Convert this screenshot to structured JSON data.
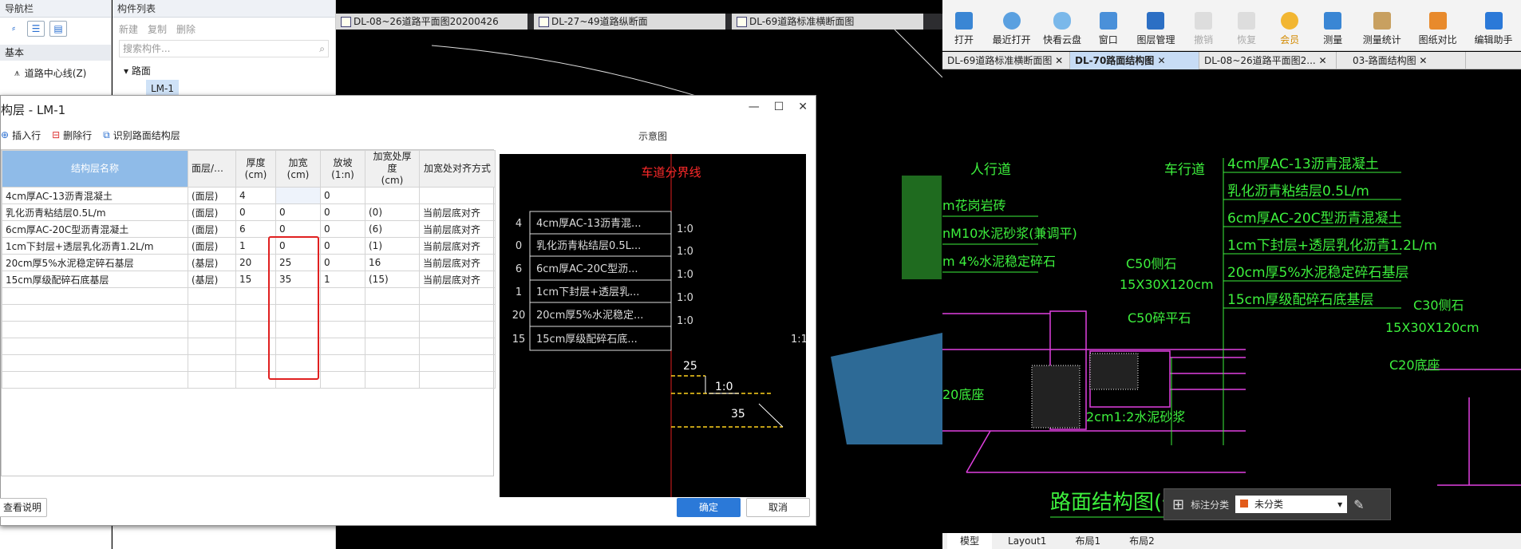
{
  "left_nav": {
    "title": "导航栏",
    "section": "基本",
    "item_label": "道路中心线(Z)"
  },
  "component_list": {
    "title": "构件列表",
    "tools": [
      "新建",
      "复制",
      "删除"
    ],
    "search_placeholder": "搜索构件...",
    "tree_root": "路面",
    "tree_child": "LM-1"
  },
  "cad_tabs": [
    "DL-08~26道路平面图20200426",
    "DL-27~49道路纵断面",
    "DL-69道路标准横断面图"
  ],
  "dialog": {
    "title": "构层 - LM-1",
    "toolbar": [
      "插入行",
      "删除行",
      "识别路面结构层"
    ],
    "scheme_title": "示意图",
    "headers": [
      "结构层名称",
      "面层/基层",
      "厚度\n(cm)",
      "加宽\n(cm)",
      "放坡\n(1:n)",
      "加宽处厚度\n(cm)",
      "加宽处对齐方式"
    ],
    "rows": [
      [
        "4cm厚AC-13沥青混凝土",
        "(面层)",
        "4",
        "",
        "0",
        "",
        ""
      ],
      [
        "乳化沥青粘结层0.5L/m",
        "(面层)",
        "0",
        "0",
        "0",
        "(0)",
        "当前层底对齐"
      ],
      [
        "6cm厚AC-20C型沥青混凝土",
        "(面层)",
        "6",
        "0",
        "0",
        "(6)",
        "当前层底对齐"
      ],
      [
        "1cm下封层+透层乳化沥青1.2L/m",
        "(面层)",
        "1",
        "0",
        "0",
        "(1)",
        "当前层底对齐"
      ],
      [
        "20cm厚5%水泥稳定碎石基层",
        "(基层)",
        "20",
        "25",
        "0",
        "16",
        "当前层底对齐"
      ],
      [
        "15cm厚级配碎石底基层",
        "(基层)",
        "15",
        "35",
        "1",
        "(15)",
        "当前层底对齐"
      ]
    ],
    "help_button": "查看说明",
    "ok_button": "确定",
    "cancel_button": "取消",
    "diagram": {
      "divider_label": "车道分界线",
      "layers": [
        {
          "n": "4",
          "label": "4cm厚AC-13沥青混...",
          "slope": "1:0"
        },
        {
          "n": "0",
          "label": "乳化沥青粘结层0.5L...",
          "slope": "1:0"
        },
        {
          "n": "6",
          "label": "6cm厚AC-20C型沥...",
          "slope": "1:0"
        },
        {
          "n": "1",
          "label": "1cm下封层+透层乳...",
          "slope": "1:0"
        },
        {
          "n": "20",
          "label": "20cm厚5%水泥稳定...",
          "slope": "1:0"
        },
        {
          "n": "15",
          "label": "15cm厚级配碎石底...",
          "slope": "1:1"
        }
      ],
      "widen_1": "25",
      "widen_2": "35"
    }
  },
  "right_app": {
    "ribbon": [
      "打开",
      "最近打开",
      "快看云盘",
      "窗口",
      "图层管理",
      "撤销",
      "恢复",
      "会员",
      "测量",
      "测量统计",
      "图纸对比",
      "编辑助手"
    ],
    "doc_tabs": [
      "DL-69道路标准横断面图",
      "DL-70路面结构图",
      "DL-08~26道路平面图2...",
      "03-路面结构图"
    ],
    "anno_label": "标注分类",
    "anno_value": "未分类",
    "layout_tabs": [
      "模型",
      "Layout1",
      "布局1",
      "布局2"
    ],
    "drawing": {
      "left_heads": [
        "人行道",
        "车行道"
      ],
      "callouts": [
        "4cm厚AC-13沥青混凝土",
        "乳化沥青粘结层0.5L/m",
        "6cm厚AC-20C型沥青混凝土",
        "1cm下封层+透层乳化沥青1.2L/m",
        "20cm厚5%水泥稳定碎石基层",
        "15cm厚级配碎石底基层"
      ],
      "left_notes": [
        "m花岗岩砖",
        "nM10水泥砂浆(兼调平)",
        "m 4%水泥稳定碎石"
      ],
      "curb_1": "C50侧石",
      "curb_1_dim": "15X30X120cm",
      "curb_2": "C50碎平石",
      "curb_3": "C30侧石",
      "curb_3_dim": "15X30X120cm",
      "c20": "C20底座",
      "mortar": "2cm1:2水泥砂浆",
      "base_20": "20底座",
      "title": "路面结构图(一)"
    }
  }
}
